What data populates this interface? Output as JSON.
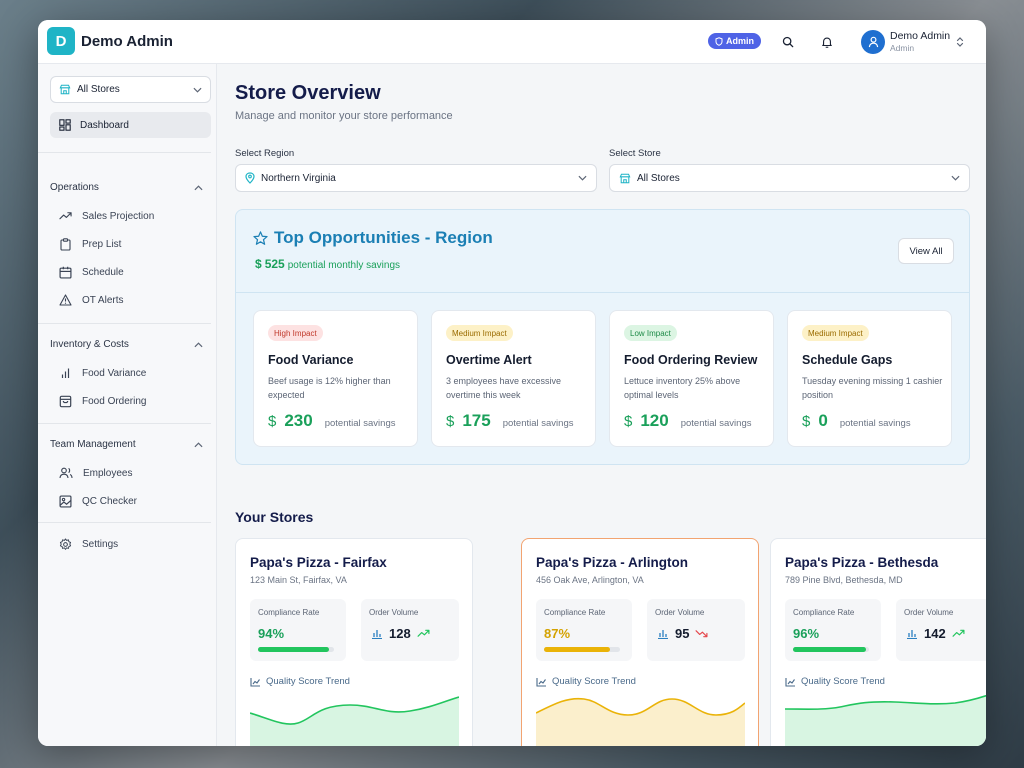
{
  "app": {
    "logo_letter": "D",
    "title": "Demo Admin"
  },
  "topbar": {
    "badge": "Admin",
    "user_name": "Demo Admin",
    "user_role": "Admin"
  },
  "sidebar": {
    "store_select": "All Stores",
    "dashboard": "Dashboard",
    "sections": [
      {
        "title": "Operations",
        "items": [
          "Sales Projection",
          "Prep List",
          "Schedule",
          "OT Alerts"
        ]
      },
      {
        "title": "Inventory & Costs",
        "items": [
          "Food Variance",
          "Food Ordering"
        ]
      },
      {
        "title": "Team Management",
        "items": [
          "Employees",
          "QC Checker"
        ]
      }
    ],
    "settings": "Settings"
  },
  "page": {
    "title": "Store Overview",
    "subtitle": "Manage and monitor your store performance",
    "region_label": "Select Region",
    "region_value": "Northern Virginia",
    "store_label": "Select Store",
    "store_value": "All Stores"
  },
  "opportunities": {
    "title": "Top Opportunities - Region",
    "savings_amount": "525",
    "savings_text": "potential monthly savings",
    "view_all": "View All",
    "cards": [
      {
        "impact": "High Impact",
        "title": "Food Variance",
        "desc": "Beef usage is 12% higher than expected",
        "amount": "230",
        "suffix": "potential savings"
      },
      {
        "impact": "Medium Impact",
        "title": "Overtime Alert",
        "desc": "3 employees have excessive overtime this week",
        "amount": "175",
        "suffix": "potential savings"
      },
      {
        "impact": "Low Impact",
        "title": "Food Ordering Review",
        "desc": "Lettuce inventory 25% above optimal levels",
        "amount": "120",
        "suffix": "potential savings"
      },
      {
        "impact": "Medium Impact",
        "title": "Schedule Gaps",
        "desc": "Tuesday evening missing 1 cashier position",
        "amount": "0",
        "suffix": "potential savings"
      }
    ]
  },
  "stores": {
    "title": "Your Stores",
    "compliance_label": "Compliance Rate",
    "order_label": "Order Volume",
    "trend_label": "Quality Score Trend",
    "list": [
      {
        "name": "Papa's Pizza - Fairfax",
        "address": "123 Main St, Fairfax, VA",
        "compliance": "94%",
        "compliance_pct": 94,
        "orders": "128",
        "trend": "up",
        "color": "#22c55e",
        "fill": "#d8f5e2"
      },
      {
        "name": "Papa's Pizza - Arlington",
        "address": "456 Oak Ave, Arlington, VA",
        "compliance": "87%",
        "compliance_pct": 87,
        "orders": "95",
        "trend": "down",
        "color": "#eab308",
        "fill": "#fbefcc"
      },
      {
        "name": "Papa's Pizza - Bethesda",
        "address": "789 Pine Blvd, Bethesda, MD",
        "compliance": "96%",
        "compliance_pct": 96,
        "orders": "142",
        "trend": "up",
        "color": "#22c55e",
        "fill": "#d8f5e2"
      }
    ]
  }
}
